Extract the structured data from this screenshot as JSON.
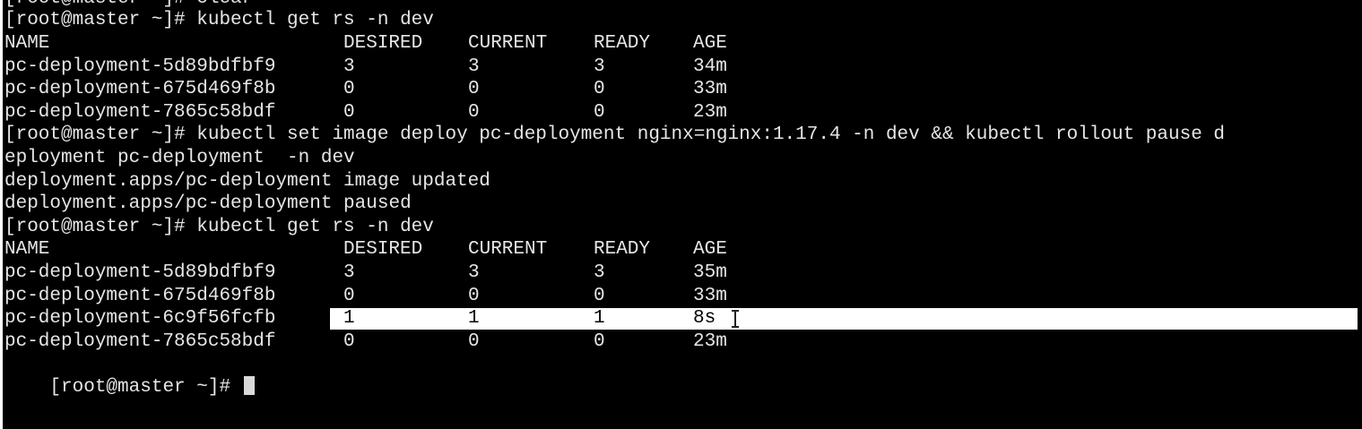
{
  "terminal": {
    "clipped_top": "[root@master ~]# clear",
    "cmd1": "[root@master ~]# kubectl get rs -n dev",
    "table1": {
      "headers": [
        "NAME",
        "DESIRED",
        "CURRENT",
        "READY",
        "AGE"
      ],
      "rows": [
        [
          "pc-deployment-5d89bdfbf9",
          "3",
          "3",
          "3",
          "34m"
        ],
        [
          "pc-deployment-675d469f8b",
          "0",
          "0",
          "0",
          "33m"
        ],
        [
          "pc-deployment-7865c58bdf",
          "0",
          "0",
          "0",
          "23m"
        ]
      ]
    },
    "cmd2_line1": "[root@master ~]# kubectl set image deploy pc-deployment nginx=nginx:1.17.4 -n dev && kubectl rollout pause d",
    "cmd2_line2": "eployment pc-deployment  -n dev",
    "out1": "deployment.apps/pc-deployment image updated",
    "out2": "deployment.apps/pc-deployment paused",
    "cmd3": "[root@master ~]# kubectl get rs -n dev",
    "table2": {
      "headers": [
        "NAME",
        "DESIRED",
        "CURRENT",
        "READY",
        "AGE"
      ],
      "rows": [
        [
          "pc-deployment-5d89bdfbf9",
          "3",
          "3",
          "3",
          "35m"
        ],
        [
          "pc-deployment-675d469f8b",
          "0",
          "0",
          "0",
          "33m"
        ],
        [
          "pc-deployment-6c9f56fcfb",
          "1",
          "1",
          "1",
          "8s"
        ],
        [
          "pc-deployment-7865c58bdf",
          "0",
          "0",
          "0",
          "23m"
        ]
      ]
    },
    "prompt": "[root@master ~]# ",
    "colors": {
      "background": "#000000",
      "foreground": "#e6e6e6",
      "selection": "#ffffff"
    }
  }
}
